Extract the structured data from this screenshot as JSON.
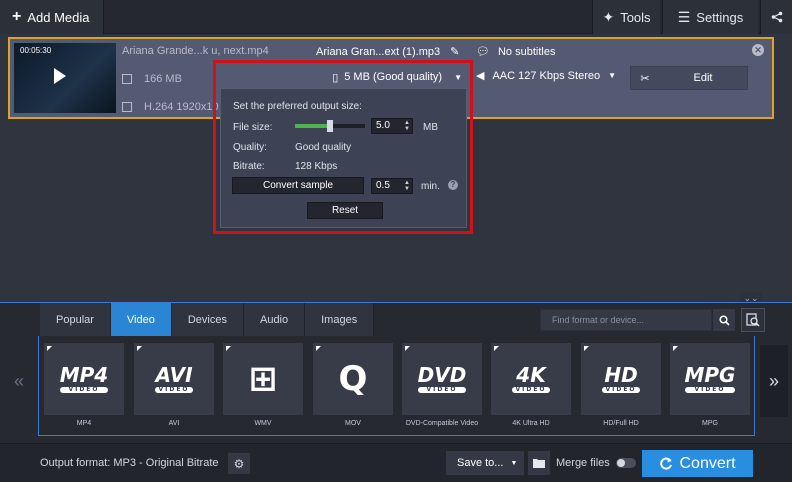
{
  "topbar": {
    "add_media": "Add Media",
    "tools": "Tools",
    "settings": "Settings"
  },
  "file": {
    "duration": "00:05:30",
    "source_name": "Ariana Grande...k u, next.mp4",
    "source_size": "166 MB",
    "source_codec": "H.264 1920x10",
    "output_name": "Ariana Gran...ext (1).mp3",
    "subtitles": "No subtitles",
    "size_quality": "5 MB (Good quality)",
    "audio": "AAC 127 Kbps Stereo",
    "edit": "Edit"
  },
  "popup": {
    "header": "Set the preferred output size:",
    "file_size_label": "File size:",
    "file_size_value": "5.0",
    "file_size_unit": "MB",
    "file_size_fraction": 0.5,
    "quality_label": "Quality:",
    "quality_value": "Good quality",
    "bitrate_label": "Bitrate:",
    "bitrate_value": "128 Kbps",
    "convert_sample": "Convert sample",
    "sample_value": "0.5",
    "sample_unit": "min.",
    "reset": "Reset"
  },
  "tabs": [
    {
      "label": "Popular",
      "active": false
    },
    {
      "label": "Video",
      "active": true
    },
    {
      "label": "Devices",
      "active": false
    },
    {
      "label": "Audio",
      "active": false
    },
    {
      "label": "Images",
      "active": false
    }
  ],
  "search": {
    "placeholder": "Find format or device..."
  },
  "formats": [
    {
      "logo": "MP4",
      "sub": "VIDEO",
      "caption": "MP4"
    },
    {
      "logo": "AVI",
      "sub": "VIDEO",
      "caption": "AVI"
    },
    {
      "logo": "⊞",
      "sub": "",
      "caption": "WMV"
    },
    {
      "logo": "Q",
      "sub": "",
      "caption": "MOV"
    },
    {
      "logo": "DVD",
      "sub": "VIDEO",
      "caption": "DVD-Compatible Video"
    },
    {
      "logo": "4K",
      "sub": "VIDEO",
      "caption": "4K Ultra HD"
    },
    {
      "logo": "HD",
      "sub": "VIDEO",
      "caption": "HD/Full HD"
    },
    {
      "logo": "MPG",
      "sub": "VIDEO",
      "caption": "MPG"
    }
  ],
  "footer": {
    "output_format": "Output format: MP3 - Original Bitrate",
    "save_to": "Save to...",
    "merge_files": "Merge files",
    "convert": "Convert"
  },
  "colors": {
    "accent": "#2a8ee0",
    "highlight_border": "#d0101a",
    "selected_file_border": "#d6a52a",
    "slider_fill": "#4db34d"
  }
}
